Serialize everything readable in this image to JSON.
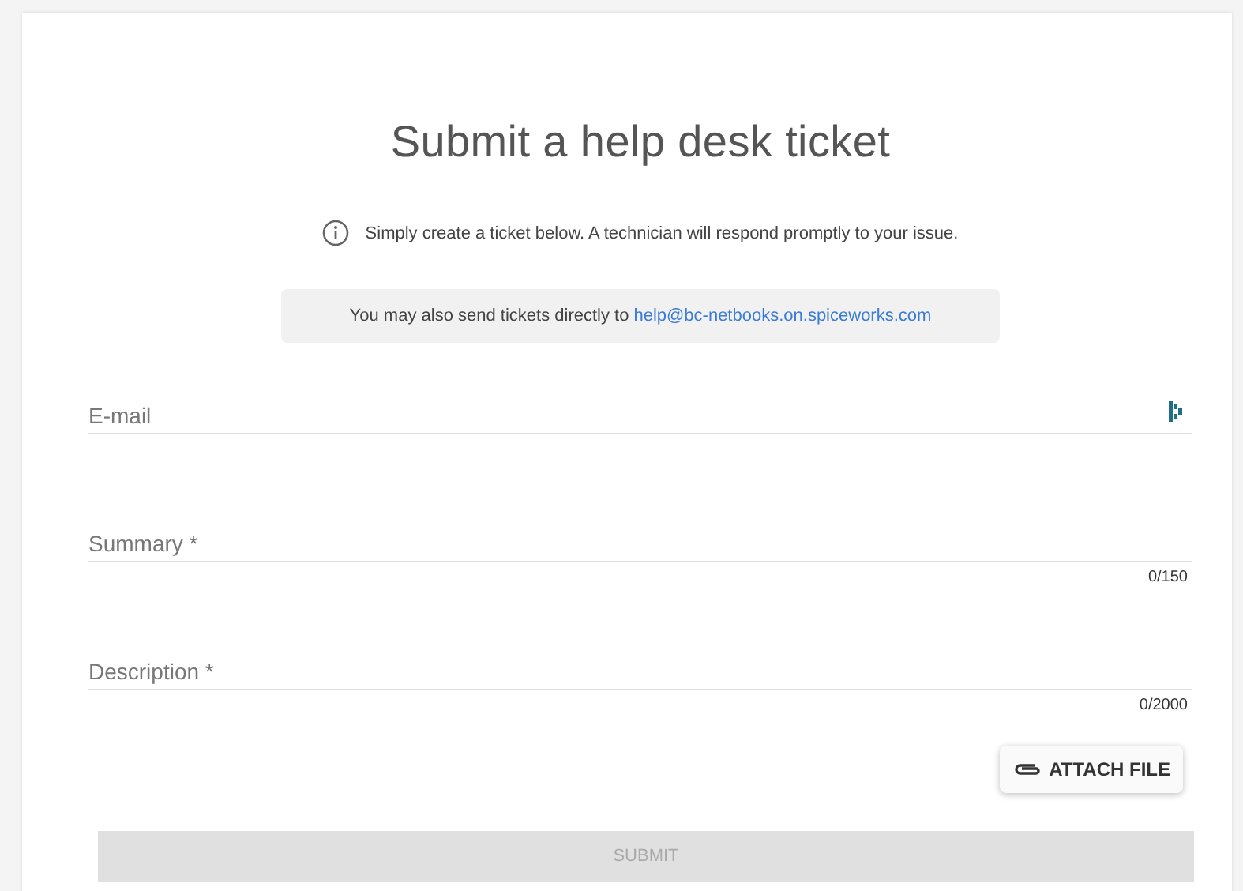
{
  "title": "Submit a help desk ticket",
  "info": "Simply create a ticket below. A technician will respond promptly to your issue.",
  "note": {
    "text": "You may also send tickets directly to",
    "link": "help@bc-netbooks.on.spiceworks.com"
  },
  "fields": [
    {
      "kind": "email",
      "label": "E-mail"
    },
    {
      "kind": "text",
      "label": "Summary *",
      "counter": "0/150"
    },
    {
      "kind": "text",
      "label": "Description *",
      "counter": "0/2000"
    }
  ],
  "attach_button": "ATTACH FILE",
  "submit": {
    "label": "SUBMIT",
    "disabled": true
  }
}
